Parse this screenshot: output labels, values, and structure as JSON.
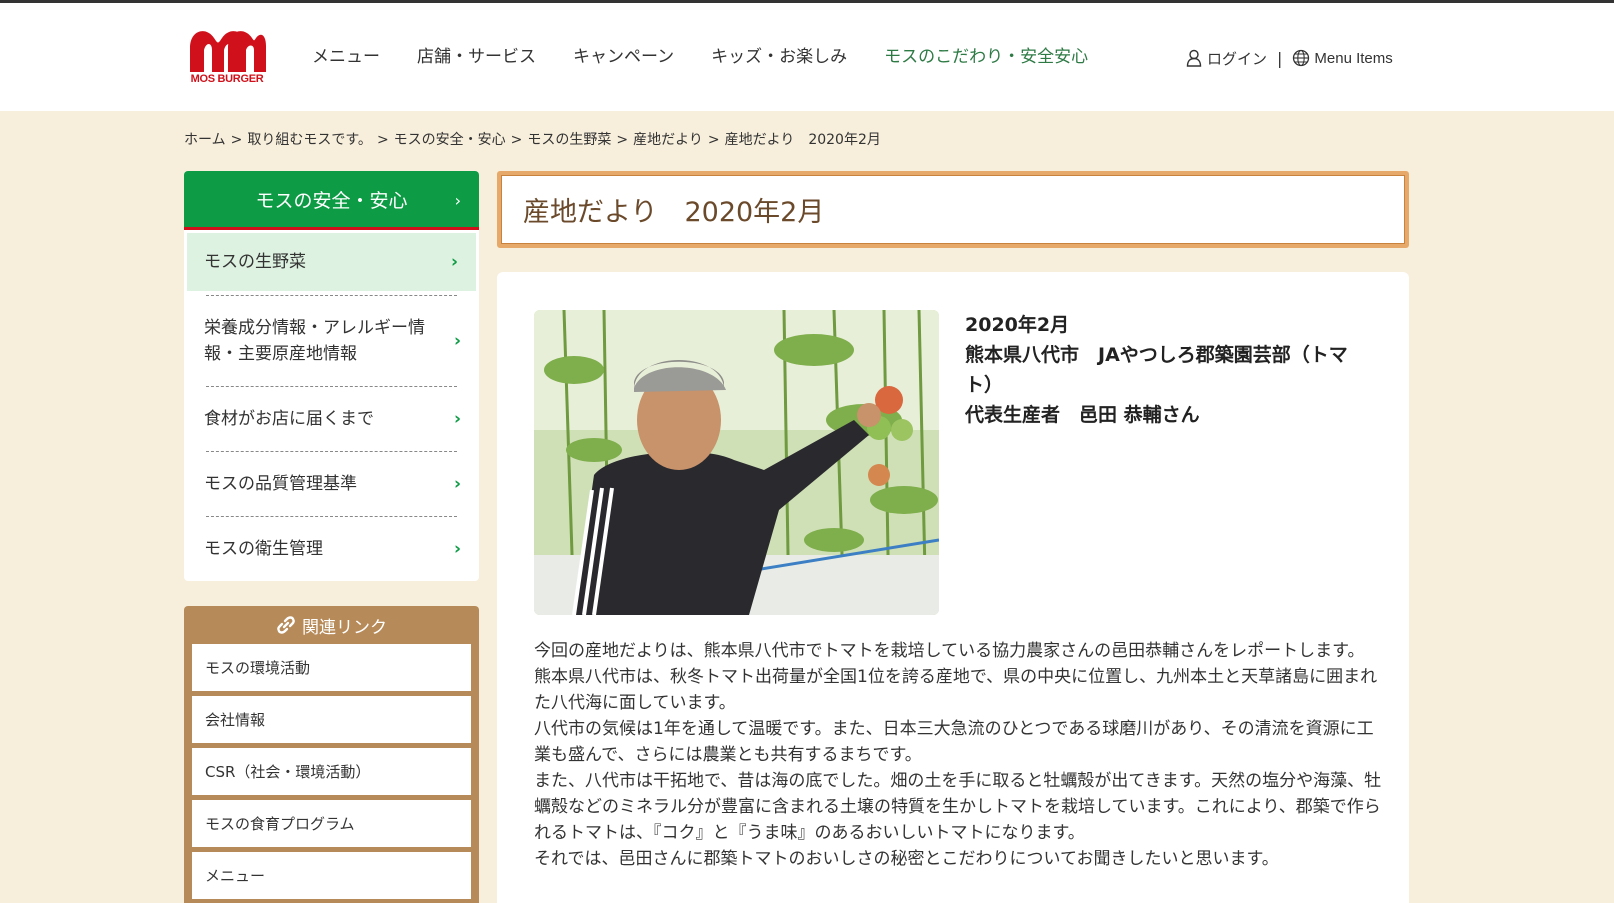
{
  "header": {
    "logo_text": "MOS BURGER",
    "nav": [
      "メニュー",
      "店舗・サービス",
      "キャンペーン",
      "キッズ・お楽しみ",
      "モスのこだわり・安全安心"
    ],
    "login_label": "ログイン",
    "separator": "|",
    "menu_items_label": "Menu Items"
  },
  "breadcrumb": [
    "ホーム",
    "取り組むモスです。",
    "モスの安全・安心",
    "モスの生野菜",
    "産地だより",
    "産地だより　2020年2月"
  ],
  "breadcrumb_sep": ">",
  "sidebar": {
    "heading": "モスの安全・安心",
    "arrow": "›",
    "items": [
      "モスの生野菜",
      "栄養成分情報・アレルギー情報・主要原産地情報",
      "食材がお店に届くまで",
      "モスの品質管理基準",
      "モスの衛生管理"
    ]
  },
  "related": {
    "heading": "関連リンク",
    "items": [
      "モスの環境活動",
      "会社情報",
      "CSR（社会・環境活動）",
      "モスの食育プログラム",
      "メニュー"
    ]
  },
  "page_title": "産地だより　2020年2月",
  "article": {
    "date": "2020年2月",
    "place": "熊本県八代市　JAやつしろ郡築園芸部（トマト）",
    "producer": "代表生産者　邑田 恭輔さん",
    "paragraphs": [
      "今回の産地だよりは、熊本県八代市でトマトを栽培している協力農家さんの邑田恭輔さんをレポートします。",
      "熊本県八代市は、秋冬トマト出荷量が全国1位を誇る産地で、県の中央に位置し、九州本土と天草諸島に囲まれた八代海に面しています。",
      "八代市の気候は1年を通して温暖です。また、日本三大急流のひとつである球磨川があり、その清流を資源に工業も盛んで、さらには農業とも共有するまちです。",
      "また、八代市は干拓地で、昔は海の底でした。畑の土を手に取ると牡蠣殻が出てきます。天然の塩分や海藻、牡蠣殻などのミネラル分が豊富に含まれる土壌の特質を生かしトマトを栽培しています。これにより、郡築で作られるトマトは、『コク』と『うま味』のあるおいしいトマトになります。",
      "それでは、邑田さんに郡築トマトのおいしさの秘密とこだわりについてお聞きしたいと思います。"
    ]
  },
  "colors": {
    "brand_red": "#d0111b",
    "green": "#0d9b46",
    "nav_current": "#2e7a45",
    "cream_bg": "#f7eedb",
    "related_brown": "#b78a59",
    "title_border": "#e6a96a"
  }
}
